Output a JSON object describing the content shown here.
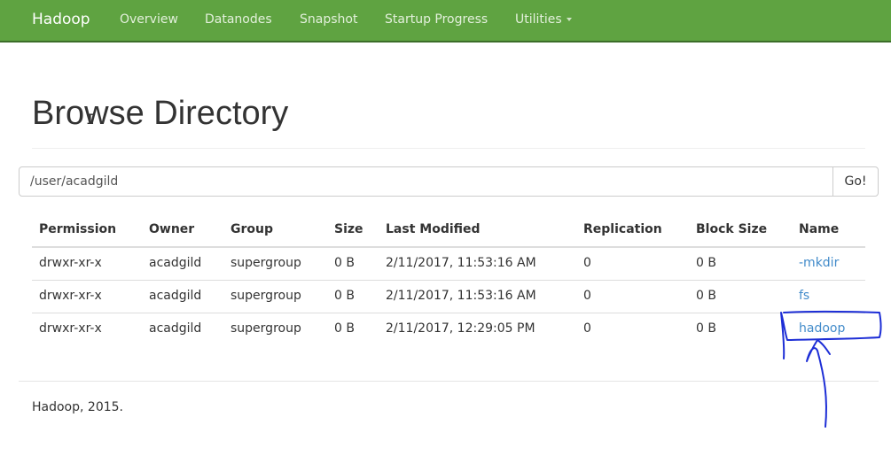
{
  "navbar": {
    "brand": "Hadoop",
    "items": [
      {
        "label": "Overview"
      },
      {
        "label": "Datanodes"
      },
      {
        "label": "Snapshot"
      },
      {
        "label": "Startup Progress"
      },
      {
        "label": "Utilities"
      }
    ]
  },
  "page": {
    "title": "Browse Directory"
  },
  "browser": {
    "path_value": "/user/acadgild",
    "go_label": "Go!"
  },
  "table": {
    "columns": [
      "Permission",
      "Owner",
      "Group",
      "Size",
      "Last Modified",
      "Replication",
      "Block Size",
      "Name"
    ],
    "rows": [
      {
        "permission": "drwxr-xr-x",
        "owner": "acadgild",
        "group": "supergroup",
        "size": "0 B",
        "modified": "2/11/2017, 11:53:16 AM",
        "replication": "0",
        "block_size": "0 B",
        "name": "-mkdir"
      },
      {
        "permission": "drwxr-xr-x",
        "owner": "acadgild",
        "group": "supergroup",
        "size": "0 B",
        "modified": "2/11/2017, 11:53:16 AM",
        "replication": "0",
        "block_size": "0 B",
        "name": "fs"
      },
      {
        "permission": "drwxr-xr-x",
        "owner": "acadgild",
        "group": "supergroup",
        "size": "0 B",
        "modified": "2/11/2017, 12:29:05 PM",
        "replication": "0",
        "block_size": "0 B",
        "name": "hadoop"
      }
    ]
  },
  "footer": {
    "text": "Hadoop, 2015."
  },
  "colors": {
    "navbar": "#5fa341",
    "link": "#428bca",
    "annotation_ink": "#1d2ed6"
  }
}
